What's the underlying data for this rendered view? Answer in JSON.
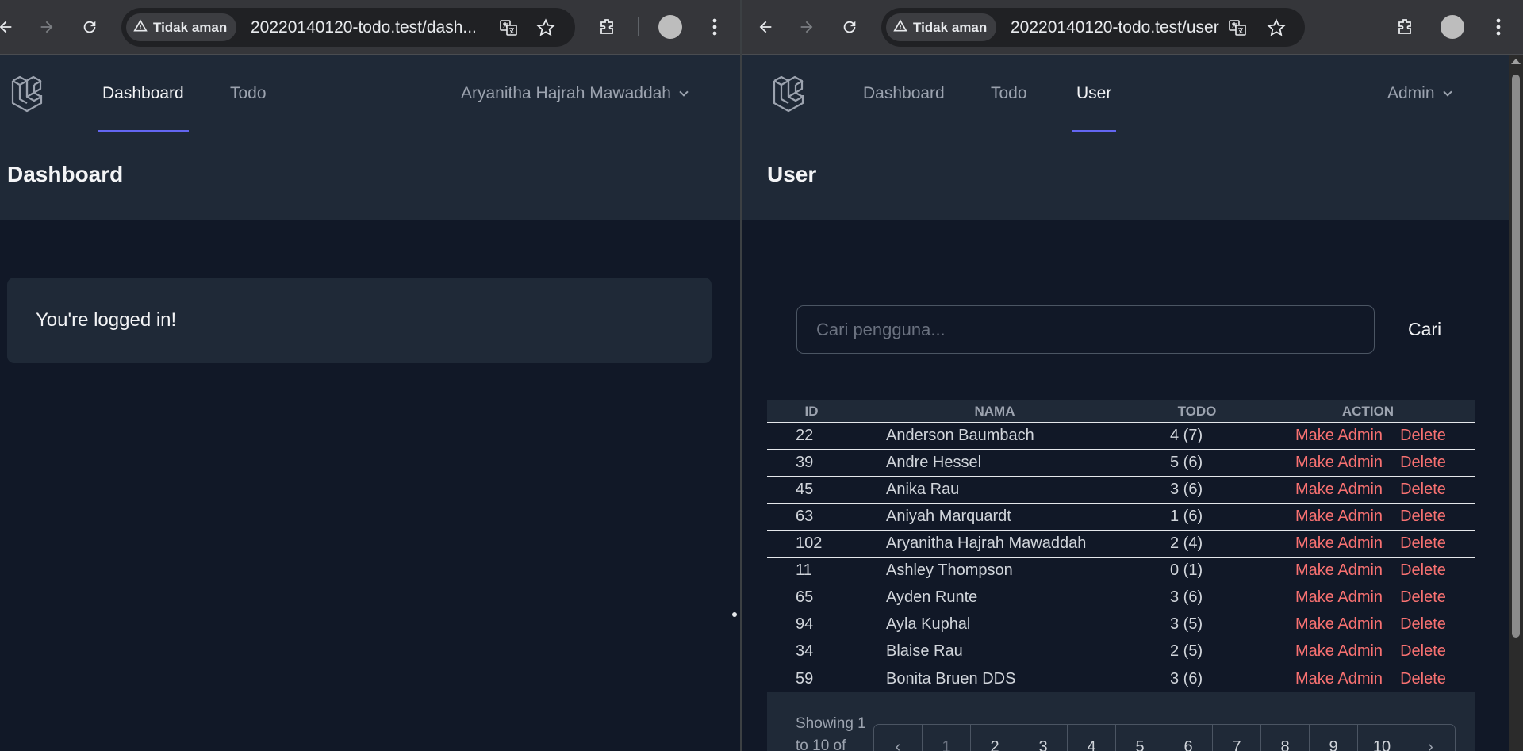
{
  "left": {
    "omnibox": {
      "security": "Tidak aman",
      "url": "20220140120-todo.test/dash..."
    },
    "nav": {
      "links": [
        "Dashboard",
        "Todo"
      ],
      "user": "Aryanitha Hajrah Mawaddah"
    },
    "page_title": "Dashboard",
    "message": "You're logged in!"
  },
  "right": {
    "omnibox": {
      "security": "Tidak aman",
      "url": "20220140120-todo.test/user"
    },
    "nav": {
      "links": [
        "Dashboard",
        "Todo",
        "User"
      ],
      "user": "Admin"
    },
    "page_title": "User",
    "search": {
      "placeholder": "Cari pengguna...",
      "value": "",
      "button": "Cari"
    },
    "table": {
      "headers": [
        "ID",
        "NAMA",
        "TODO",
        "ACTION"
      ],
      "action_labels": [
        "Make Admin",
        "Delete"
      ],
      "rows": [
        {
          "id": "22",
          "nama": "Anderson Baumbach",
          "todo": "4 (7)"
        },
        {
          "id": "39",
          "nama": "Andre Hessel",
          "todo": "5 (6)"
        },
        {
          "id": "45",
          "nama": "Anika Rau",
          "todo": "3 (6)"
        },
        {
          "id": "63",
          "nama": "Aniyah Marquardt",
          "todo": "1 (6)"
        },
        {
          "id": "102",
          "nama": "Aryanitha Hajrah Mawaddah",
          "todo": "2 (4)"
        },
        {
          "id": "11",
          "nama": "Ashley Thompson",
          "todo": "0 (1)"
        },
        {
          "id": "65",
          "nama": "Ayden Runte",
          "todo": "3 (6)"
        },
        {
          "id": "94",
          "nama": "Ayla Kuphal",
          "todo": "3 (5)"
        },
        {
          "id": "34",
          "nama": "Blaise Rau",
          "todo": "2 (5)"
        },
        {
          "id": "59",
          "nama": "Bonita Bruen DDS",
          "todo": "3 (6)"
        }
      ]
    },
    "pagination": {
      "showing_text": "Showing 1 to 10 of",
      "prev": "‹",
      "pages": [
        "1",
        "2",
        "3",
        "4",
        "5",
        "6",
        "7",
        "8",
        "9",
        "10"
      ],
      "next": "›"
    }
  },
  "colors": {
    "accent": "#6366f1",
    "danger": "#f87171",
    "bg": "#111827",
    "panel": "#1f2937"
  }
}
